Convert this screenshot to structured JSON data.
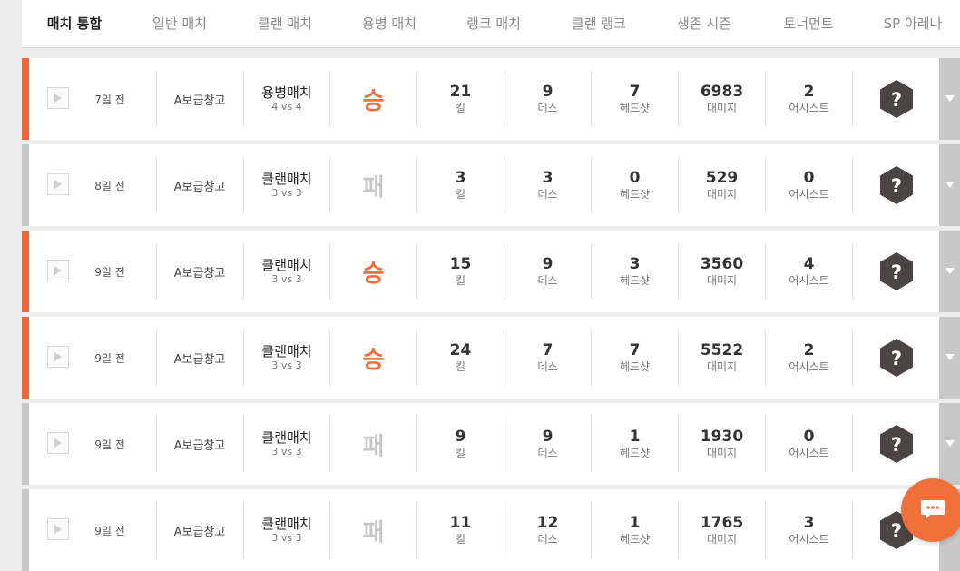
{
  "tabs": [
    {
      "label": "매치 통합",
      "active": true
    },
    {
      "label": "일반 매치",
      "active": false
    },
    {
      "label": "클랜 매치",
      "active": false
    },
    {
      "label": "용병 매치",
      "active": false
    },
    {
      "label": "랭크 매치",
      "active": false
    },
    {
      "label": "클랜 랭크",
      "active": false
    },
    {
      "label": "생존 시즌",
      "active": false
    },
    {
      "label": "토너먼트",
      "active": false
    },
    {
      "label": "SP 아레나",
      "active": false
    }
  ],
  "stat_labels": {
    "kill": "킬",
    "death": "데스",
    "headshot": "헤드샷",
    "damage": "대미지",
    "assist": "어시스트"
  },
  "colors": {
    "win": "#f0703c",
    "loss": "#c6c6c6",
    "stripe_win": "#f0643a",
    "stripe_loss": "#c8c8c8",
    "badge": "#4a4542"
  },
  "matches": [
    {
      "date": "7일 전",
      "map": "A보급창고",
      "match_type": "용병매치",
      "mode": "4 vs 4",
      "result": "승",
      "outcome": "win",
      "kill": "21",
      "death": "9",
      "headshot": "7",
      "damage": "6983",
      "assist": "2",
      "badge": "?"
    },
    {
      "date": "8일 전",
      "map": "A보급창고",
      "match_type": "클랜매치",
      "mode": "3 vs 3",
      "result": "패",
      "outcome": "loss",
      "kill": "3",
      "death": "3",
      "headshot": "0",
      "damage": "529",
      "assist": "0",
      "badge": "?"
    },
    {
      "date": "9일 전",
      "map": "A보급창고",
      "match_type": "클랜매치",
      "mode": "3 vs 3",
      "result": "승",
      "outcome": "win",
      "kill": "15",
      "death": "9",
      "headshot": "3",
      "damage": "3560",
      "assist": "4",
      "badge": "?"
    },
    {
      "date": "9일 전",
      "map": "A보급창고",
      "match_type": "클랜매치",
      "mode": "3 vs 3",
      "result": "승",
      "outcome": "win",
      "kill": "24",
      "death": "7",
      "headshot": "7",
      "damage": "5522",
      "assist": "2",
      "badge": "?"
    },
    {
      "date": "9일 전",
      "map": "A보급창고",
      "match_type": "클랜매치",
      "mode": "3 vs 3",
      "result": "패",
      "outcome": "loss",
      "kill": "9",
      "death": "9",
      "headshot": "1",
      "damage": "1930",
      "assist": "0",
      "badge": "?"
    },
    {
      "date": "9일 전",
      "map": "A보급창고",
      "match_type": "클랜매치",
      "mode": "3 vs 3",
      "result": "패",
      "outcome": "loss",
      "kill": "11",
      "death": "12",
      "headshot": "1",
      "damage": "1765",
      "assist": "3",
      "badge": "?"
    }
  ],
  "icons": {
    "play": "play-icon",
    "expand": "chevron-down-icon",
    "chat": "chat-bubble-icon",
    "badge": "hexagon-badge-icon"
  }
}
